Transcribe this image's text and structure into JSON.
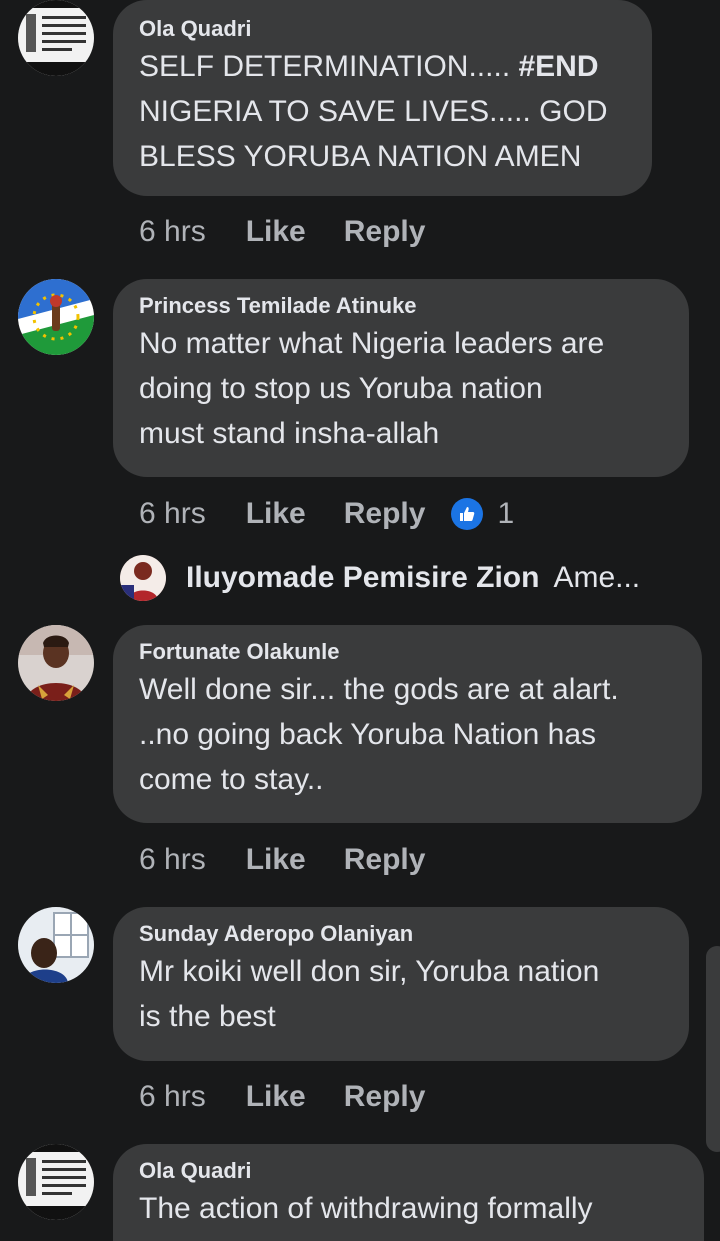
{
  "comments": [
    {
      "author": "Ola Quadri",
      "text_pre": "SELF DETERMINATION..... ",
      "text_bold": "#END",
      "text_post": "\nNIGERIA TO SAVE LIVES..... GOD\nBLESS YORUBA NATION AMEN",
      "time": "6 hrs",
      "like": "Like",
      "reply": "Reply",
      "avatar_icon": "text-badge-avatar-icon"
    },
    {
      "author": "Princess Temilade Atinuke",
      "text": "No matter what Nigeria leaders are\ndoing to stop us Yoruba nation\nmust stand insha-allah",
      "time": "6 hrs",
      "like": "Like",
      "reply": "Reply",
      "reaction_count": "1",
      "avatar_icon": "flag-emblem-avatar-icon"
    },
    {
      "author": "Fortunate Olakunle",
      "text": "Well done sir... the gods are at alart.\n..no going back Yoruba Nation has\ncome to stay..",
      "time": "6 hrs",
      "like": "Like",
      "reply": "Reply",
      "avatar_icon": "person-photo-avatar-icon"
    },
    {
      "author": "Sunday Aderopo Olaniyan",
      "text": "Mr koiki well don sir, Yoruba nation\nis the best",
      "time": "6 hrs",
      "like": "Like",
      "reply": "Reply",
      "avatar_icon": "person-photo-avatar-icon"
    },
    {
      "author": "Ola Quadri",
      "text": "The action of withdrawing formally",
      "avatar_icon": "text-badge-avatar-icon"
    }
  ],
  "reply_preview": {
    "name": "Iluyomade Pemisire Zion",
    "snippet": "Ame..."
  },
  "colors": {
    "background": "#18191a",
    "bubble": "#3a3b3c",
    "primary_text": "#e4e6eb",
    "secondary_text": "#b0b3b8",
    "like_blue": "#1b74e4"
  }
}
